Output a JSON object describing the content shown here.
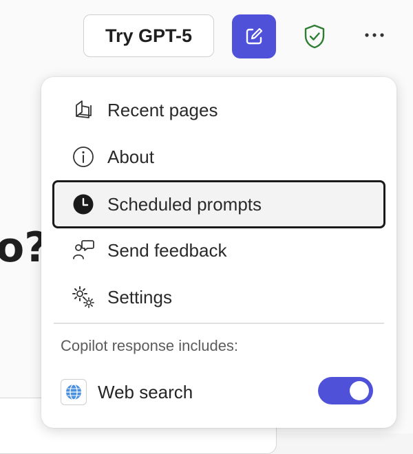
{
  "topbar": {
    "try_label": "Try GPT-5",
    "icons": [
      "compose-icon",
      "shield-check-icon",
      "more-icon"
    ]
  },
  "background": {
    "heading_fragment": "o?"
  },
  "menu": {
    "items": [
      {
        "label": "Recent pages",
        "icon": "book-icon"
      },
      {
        "label": "About",
        "icon": "info-icon"
      },
      {
        "label": "Scheduled prompts",
        "icon": "clock-icon"
      },
      {
        "label": "Send feedback",
        "icon": "feedback-icon"
      },
      {
        "label": "Settings",
        "icon": "gear-icon"
      }
    ],
    "section_label": "Copilot response includes:",
    "web_search": {
      "label": "Web search",
      "enabled": true,
      "icon": "globe-icon"
    }
  },
  "colors": {
    "accent": "#4f52d9",
    "shield_green": "#2e7d32"
  }
}
